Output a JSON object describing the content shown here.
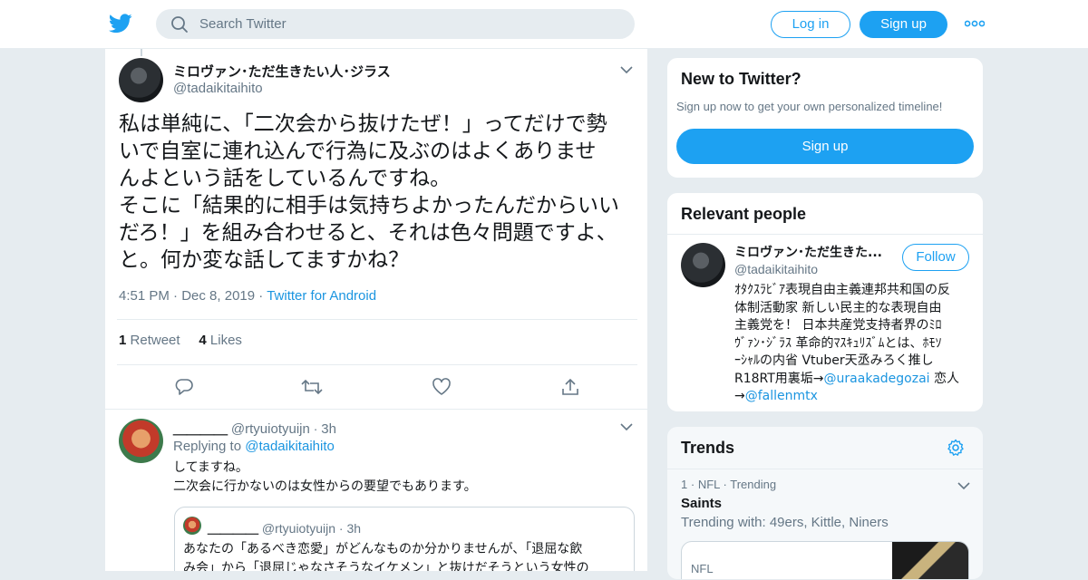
{
  "header": {
    "search_placeholder": "Search Twitter",
    "login_label": "Log in",
    "signup_label": "Sign up",
    "brand_color": "#1da1f2"
  },
  "tweet": {
    "display_name": "ミロヴァン･ただ生きたい人･ジラス",
    "handle": "@tadaikitaihito",
    "text_lines": [
      "私は単純に、「二次会から抜けたぜ！」ってだけで勢",
      "いで自室に連れ込んで行為に及ぶのはよくありませ",
      "んよという話をしているんですね。",
      "そこに「結果的に相手は気持ちよかったんだからいい",
      "だろ！」を組み合わせると、それは色々問題ですよ、",
      "と。何か変な話してますかね？"
    ],
    "time": "4:51 PM",
    "date": "Dec 8, 2019",
    "source": "Twitter for Android",
    "retweet_count": "1",
    "retweet_label": "Retweet",
    "like_count": "4",
    "like_label": "Likes"
  },
  "reply": {
    "display_name": "＿＿＿＿",
    "handle": "@rtyuiotyuijn",
    "time": "3h",
    "replying_to_label": "Replying to",
    "replying_to_handle": "@tadaikitaihito",
    "text_lines": [
      "してますね。",
      "二次会に行かないのは女性からの要望でもあります。"
    ],
    "quote": {
      "display_name": "＿＿＿＿",
      "handle": "@rtyuiotyuijn",
      "time": "3h",
      "text_lines": [
        "あなたの「あるべき恋愛」がどんなものか分かりませんが、「退屈な飲",
        "み会」から「退屈じゃなさそうなイケメン」と抜けだそうという女性の"
      ]
    }
  },
  "sidebar": {
    "new_to_twitter": {
      "title": "New to Twitter?",
      "subtitle": "Sign up now to get your own personalized timeline!",
      "signup_label": "Sign up"
    },
    "relevant_people": {
      "title": "Relevant people",
      "person": {
        "display_name": "ミロヴァン･ただ生きた...",
        "handle": "@tadaikitaihito",
        "follow_label": "Follow",
        "bio_lines": [
          "ｵﾀｸｽﾗﾋﾞｱ表現自由主義連邦共和国の反",
          "体制活動家 新しい民主的な表現自由",
          "主義党を！ 日本共産党支持者界のﾐﾛ",
          "ｳﾞｧﾝ･ｼﾞﾗｽ 革命的ﾏｽｷｭﾘｽﾞﾑとは、ﾎﾓｿ",
          "ｰｼｬﾙの内省 Vtuber天丞みろく推し"
        ],
        "bio_line6_prefix": "R18RT用裏垢→",
        "bio_link1": "@uraakadegozai",
        "bio_line6_suffix": " 恋人",
        "bio_line7_prefix": "→",
        "bio_link2": "@fallenmtx"
      }
    },
    "trends": {
      "title": "Trends",
      "item1": {
        "rank_line_rank": "1",
        "rank_line_cat": "NFL",
        "rank_line_status": "Trending",
        "name": "Saints",
        "with": "Trending with: 49ers, Kittle, Niners"
      },
      "item2_category": "NFL"
    }
  }
}
